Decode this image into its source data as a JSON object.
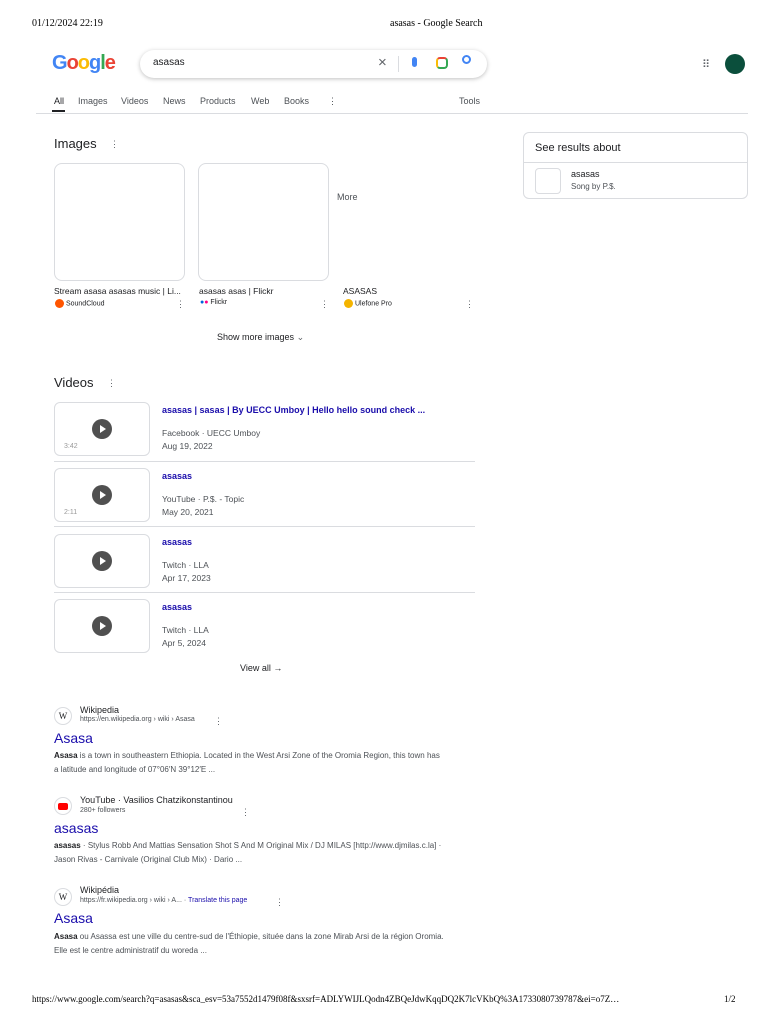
{
  "print_header": {
    "datetime": "01/12/2024 22:19",
    "title": "asasas - Google Search"
  },
  "print_footer": {
    "url": "https://www.google.com/search?q=asasas&sca_esv=53a7552d1479f08f&sxsrf=ADLYWIJLQodn4ZBQeJdwKqqDQ2K7lcVKbQ%3A1733080739787&ei=o7Z…",
    "page": "1/2"
  },
  "logo": "Google",
  "search": {
    "value": "asasas"
  },
  "tabs": [
    "All",
    "Images",
    "Videos",
    "News",
    "Products",
    "Web",
    "Books",
    "More"
  ],
  "tools": "Tools",
  "images": {
    "heading": "Images",
    "items": [
      {
        "caption": "Stream asasa asasas music | Li...",
        "source": "SoundCloud",
        "color": "#ff5500"
      },
      {
        "caption": "asasas asas | Flickr",
        "source": "Flickr",
        "color": "#ff0084"
      },
      {
        "caption": "ASASAS",
        "source": "Ulefone Pro",
        "color": "#f4b400"
      }
    ],
    "show_more": "Show more images"
  },
  "videos": {
    "heading": "Videos",
    "items": [
      {
        "title": "asasas | sasas | By UECC Umboy | Hello hello sound check ...",
        "meta": "Facebook · UECC Umboy",
        "date": "Aug 19, 2022",
        "duration": "3:42"
      },
      {
        "title": "asasas",
        "meta": "YouTube · P.$. - Topic",
        "date": "May 20, 2021",
        "duration": "2:11"
      },
      {
        "title": "asasas",
        "meta": "Twitch · LLA",
        "date": "Apr 17, 2023",
        "duration": ""
      },
      {
        "title": "asasas",
        "meta": "Twitch · LLA",
        "date": "Apr 5, 2024",
        "duration": ""
      }
    ],
    "view_all": "View all"
  },
  "results": [
    {
      "site": "Wikipedia",
      "url": "https://en.wikipedia.org › wiki › Asasa",
      "title": "Asasa",
      "bold": "Asasa",
      "snippet": " is a town in southeastern Ethiopia. Located in the West Arsi Zone of the Oromia Region, this town has a latitude and longitude of 07°06′N 39°12′E ..."
    },
    {
      "site": "YouTube · Vasilios Chatzikonstantinou",
      "url": "280+ followers",
      "title": "asasas",
      "bold": "asasas",
      "snippet": " · Stylus Robb And Mattias Sensation Shot S And M Original Mix / DJ MILAS [http://www.djmilas.c.la] · Jason Rivas - Carnivale (Original Club Mix) · Dario ..."
    },
    {
      "site": "Wikipédia",
      "url": "https://fr.wikipedia.org › wiki › A...",
      "translate": "Translate this page",
      "title": "Asasa",
      "bold": "Asasa",
      "snippet": " ou Asassa est une ville du centre-sud de l'Éthiopie, située dans la zone Mirab Arsi de la région Oromia. Elle est le centre administratif du woreda ..."
    }
  ],
  "knowledge": {
    "heading": "See results about",
    "item_title": "asasas",
    "item_sub": "Song by P.$."
  }
}
